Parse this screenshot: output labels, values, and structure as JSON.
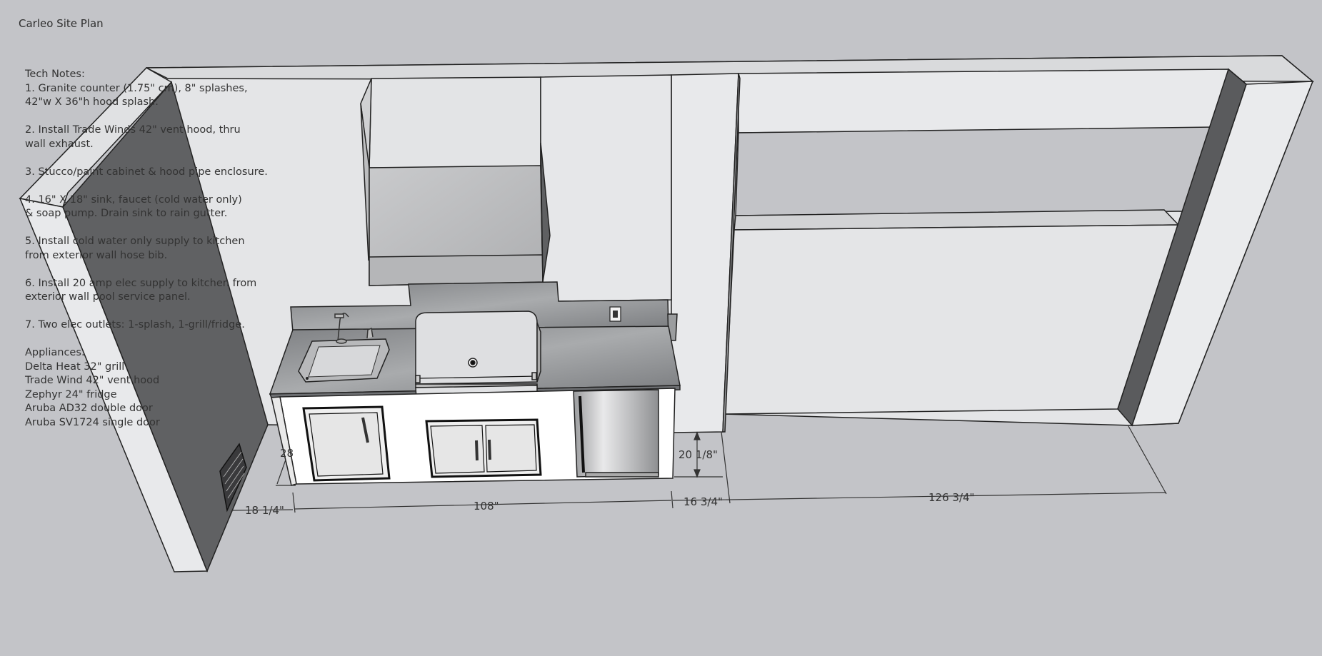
{
  "title": "Carleo Site Plan",
  "notes": {
    "heading": "Tech Notes:",
    "items": [
      [
        "1. Granite counter (1.75\" cm), 8\" splashes,",
        "42\"w X 36\"h hood splash."
      ],
      [
        "2. Install Trade Winds 42\" vent hood, thru",
        "wall exhaust."
      ],
      [
        "3. Stucco/paint cabinet & hood pipe enclosure."
      ],
      [
        "4. 16\" X 18\" sink, faucet (cold water only)",
        "& soap pump. Drain sink to rain gutter."
      ],
      [
        "5. Install cold water only supply to kitchen",
        "from exterior wall hose bib."
      ],
      [
        "6. Install 20 amp elec supply to kitchen from",
        "exterior wall pool service panel."
      ],
      [
        "7. Two elec outlets: 1-splash, 1-grill/fridge."
      ]
    ],
    "appliances_heading": "Appliances:",
    "appliances": [
      "Delta Heat 32\" grill",
      "Trade Wind 42\" vent hood",
      "Zephyr 24\" fridge",
      "Aruba AD32 double door",
      "Aruba SV1724 single door"
    ]
  },
  "dimensions": {
    "depth": "28",
    "left_return": "18 1/4\"",
    "island": "108\"",
    "gap": "16 3/4\"",
    "height": "20 1/8\"",
    "bar": "126 3/4\""
  },
  "colors": {
    "background": "#c3c4c8",
    "wall": "#e6e7e9",
    "wall_shadow": "#5f6062",
    "granite": "#8c8e91",
    "cabinet": "#ffffff",
    "steel": "#cfd0d2"
  }
}
